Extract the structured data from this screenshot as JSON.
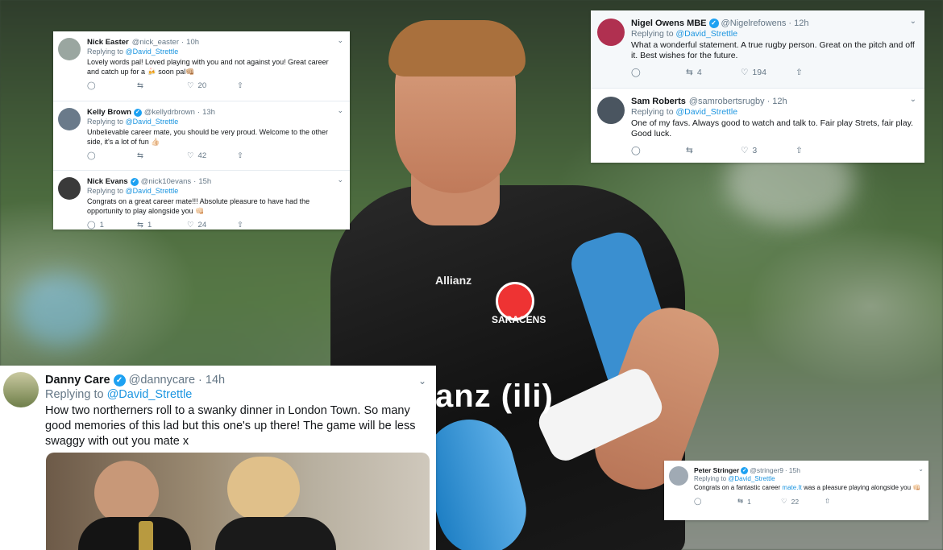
{
  "colors": {
    "link": "#1b95e0",
    "verified": "#1da1f2",
    "muted": "#657786"
  },
  "icons": [
    "reply-icon",
    "retweet-icon",
    "like-icon",
    "share-icon",
    "verified-icon",
    "chevron-down-icon"
  ],
  "background": {
    "logo_text": "Allianz",
    "club_text": "SARACENS",
    "sponsor_text": "anz (ili)"
  },
  "reply_prefix": "Replying to",
  "reply_target": "@David_Strettle",
  "card_left": {
    "tweets": [
      {
        "name": "Nick Easter",
        "handle": "@nick_easter",
        "dot": "·",
        "time": "10h",
        "verified": false,
        "text": "Lovely words pal! Loved playing with you and not against you! Great career and catch up for a 🍻 soon pal👊🏼",
        "replies": "",
        "retweets": "",
        "likes": "20"
      },
      {
        "name": "Kelly Brown",
        "handle": "@kellydrbrown",
        "dot": "·",
        "time": "13h",
        "verified": true,
        "text": "Unbelievable career mate, you should be very proud. Welcome to the other side, it's a lot of fun 👍🏻",
        "replies": "",
        "retweets": "",
        "likes": "42"
      },
      {
        "name": "Nick Evans",
        "handle": "@nick10evans",
        "dot": "·",
        "time": "15h",
        "verified": true,
        "text": "Congrats on a great career mate!!! Absolute pleasure to have had the opportunity to play alongside you 👊🏻",
        "replies": "1",
        "retweets": "1",
        "likes": "24"
      }
    ]
  },
  "card_right": {
    "tweets": [
      {
        "name": "Nigel Owens MBE",
        "handle": "@Nigelrefowens",
        "dot": "·",
        "time": "12h",
        "verified": true,
        "text": "What a wonderful statement. A true rugby person. Great on the pitch and off it. Best wishes for the future.",
        "replies": "",
        "retweets": "4",
        "likes": "194"
      },
      {
        "name": "Sam Roberts",
        "handle": "@samrobertsrugby",
        "dot": "·",
        "time": "12h",
        "verified": false,
        "text": "One of my favs. Always good to watch and talk to. Fair play Strets, fair play. Good luck.",
        "replies": "",
        "retweets": "",
        "likes": "3"
      }
    ]
  },
  "card_big": {
    "name": "Danny Care",
    "handle": "@dannycare",
    "dot": "·",
    "time": "14h",
    "verified": true,
    "text": "How two northerners roll to a swanky dinner in London Town. So many good memories of this lad but this one's up there! The game will be less swaggy with out you mate x"
  },
  "card_small": {
    "name": "Peter Stringer",
    "handle": "@stringer9",
    "dot": "·",
    "time": "15h",
    "verified": true,
    "text_before": "Congrats on a fantastic career",
    "text_link": "mate.It",
    "text_after": "was a pleasure playing alongside you 👊🏻",
    "replies": "",
    "retweets": "1",
    "likes": "22"
  }
}
